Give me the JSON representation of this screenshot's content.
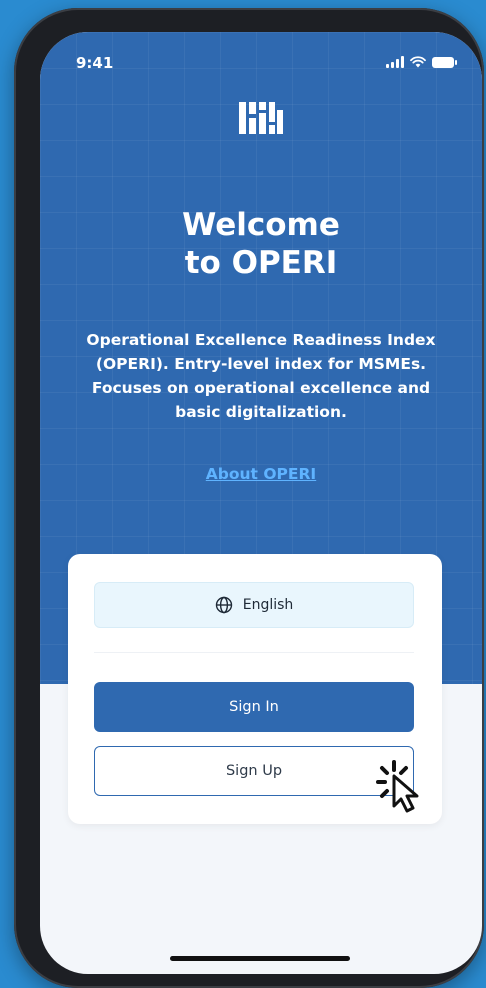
{
  "status_bar": {
    "time": "9:41"
  },
  "hero": {
    "title_line1": "Welcome",
    "title_line2": "to OPERI",
    "description": "Operational Excellence Readiness Index (OPERI). Entry-level index for MSMEs. Focuses on operational excellence and basic digitalization.",
    "about_link": "About OPERI"
  },
  "card": {
    "language_label": "English",
    "sign_in_label": "Sign In",
    "sign_up_label": "Sign Up"
  },
  "colors": {
    "primary": "#2f69b0",
    "link": "#5fb3ff",
    "background": "#2a8bd0",
    "language_bg": "#e9f6fd"
  },
  "icons": [
    "globe-icon",
    "signal-icon",
    "wifi-icon",
    "battery-icon",
    "app-logo",
    "pointer-cursor-icon"
  ]
}
